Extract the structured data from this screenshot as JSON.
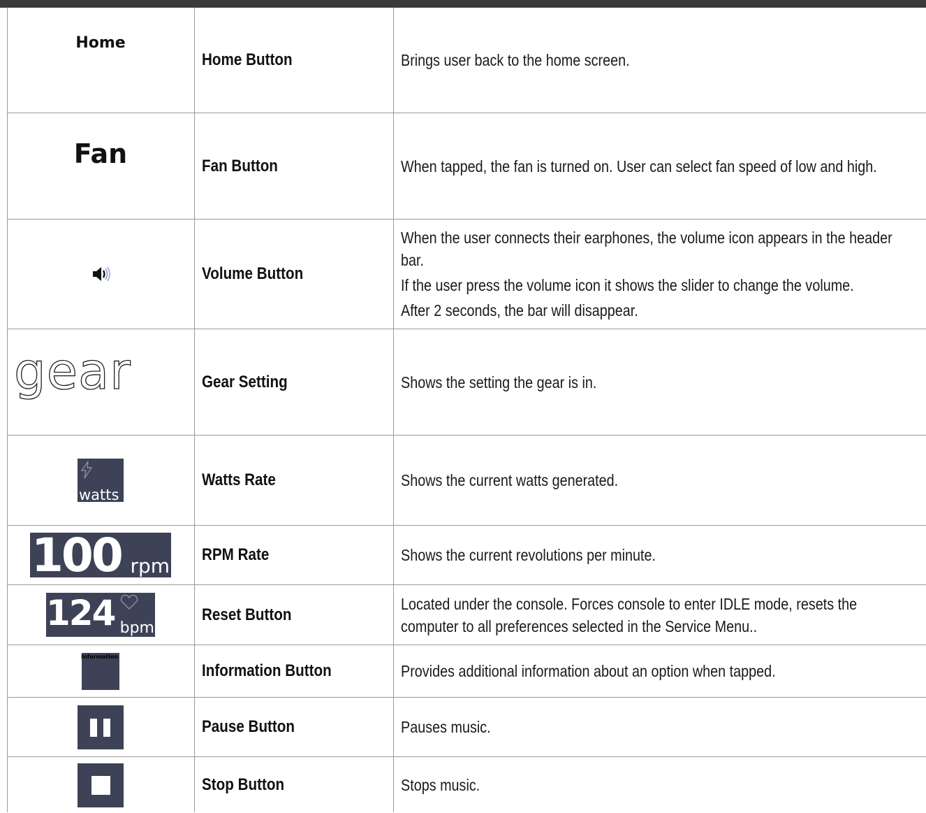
{
  "rows": [
    {
      "icon_label": "Home",
      "name": "Home Button",
      "desc": [
        "Brings user back to the home screen."
      ]
    },
    {
      "icon_label": "Fan",
      "name": "Fan Button",
      "desc": [
        "When tapped, the fan is turned on. User can select fan speed of low and high."
      ]
    },
    {
      "icon": "volume-icon",
      "name": "Volume Button",
      "desc": [
        "When the user connects their earphones, the volume icon appears in the header bar.",
        "If the user press the volume icon it shows the slider to change the volume.",
        "After 2 seconds, the bar will disappear."
      ]
    },
    {
      "icon_label": "gear",
      "name": "Gear Setting",
      "desc": [
        "Shows the setting the gear is in."
      ]
    },
    {
      "icon": "bolt-icon",
      "icon_label": "watts",
      "name": "Watts Rate",
      "desc": [
        "Shows the current watts generated."
      ]
    },
    {
      "icon_value": "100",
      "icon_unit": "rpm",
      "name": "RPM Rate",
      "desc": [
        "Shows the current revolutions per minute."
      ]
    },
    {
      "icon": "heart-icon",
      "icon_value": "124",
      "icon_unit": "bpm",
      "name": "Reset Button",
      "desc": [
        "Located under the console. Forces console to enter IDLE mode, resets the computer to all preferences selected in the Service Menu.."
      ]
    },
    {
      "icon_label": "Information",
      "name": "Information Button",
      "desc": [
        "Provides additional information about an option when tapped."
      ]
    },
    {
      "icon": "pause-icon",
      "name": "Pause Button",
      "desc": [
        "Pauses music."
      ]
    },
    {
      "icon": "stop-icon",
      "name": "Stop Button",
      "desc": [
        "Stops music."
      ]
    }
  ],
  "colors": {
    "header_bar": "#3a3a3a",
    "icon_tile": "#3d4257",
    "border": "#9a9a9a"
  }
}
